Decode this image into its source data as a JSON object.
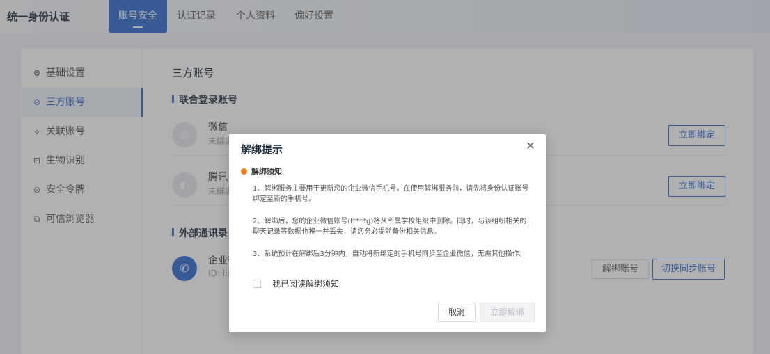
{
  "header": {
    "app_title": "统一身份认证",
    "tabs": [
      {
        "label": "账号安全"
      },
      {
        "label": "认证记录"
      },
      {
        "label": "个人资料"
      },
      {
        "label": "偏好设置"
      }
    ]
  },
  "sidebar": {
    "items": [
      {
        "label": "基础设置",
        "icon": "gear-icon"
      },
      {
        "label": "三方账号",
        "icon": "link-icon"
      },
      {
        "label": "关联账号",
        "icon": "chain-icon"
      },
      {
        "label": "生物识别",
        "icon": "face-scan-icon"
      },
      {
        "label": "安全令牌",
        "icon": "shield-icon"
      },
      {
        "label": "可信浏览器",
        "icon": "browser-icon"
      }
    ]
  },
  "main": {
    "title": "三方账号",
    "section1_title": "联合登录账号",
    "accounts": [
      {
        "name": "微信",
        "sub": "未绑定",
        "button": "立即绑定",
        "icon": "wechat-icon"
      },
      {
        "name": "腾讯",
        "sub": "未绑定",
        "button": "立即绑定",
        "icon": "qq-icon"
      }
    ],
    "section2_title": "外部通讯录",
    "external": {
      "name": "企业微信",
      "sub": "ID: lis",
      "unbind_button": "解绑账号",
      "switch_button": "切换同步账号",
      "icon": "wecom-icon"
    }
  },
  "modal": {
    "title": "解绑提示",
    "notice_title": "解绑须知",
    "notice_dot_color": "#f07d1d",
    "paragraphs": [
      "1、解绑服务主要用于更新您的企业微信手机号。在使用解绑服务前，请先将身份认证账号绑定至新的手机号。",
      "2、解绑后，您的企业微信账号(l****g)将从所属学校组织中删除。同时，与该组织相关的聊天记录等数据也将一并丢失，请您务必提前备份相关信息。",
      "3、系统预计在解绑后3分钟内，自动将新绑定的手机号同步至企业微信，无需其他操作。"
    ],
    "agree_label": "我已阅读解绑须知",
    "cancel_label": "取消",
    "confirm_label": "立即解绑"
  },
  "colors": {
    "primary": "#2f6bd2",
    "overlay": "rgba(70,70,70,0.42)"
  }
}
